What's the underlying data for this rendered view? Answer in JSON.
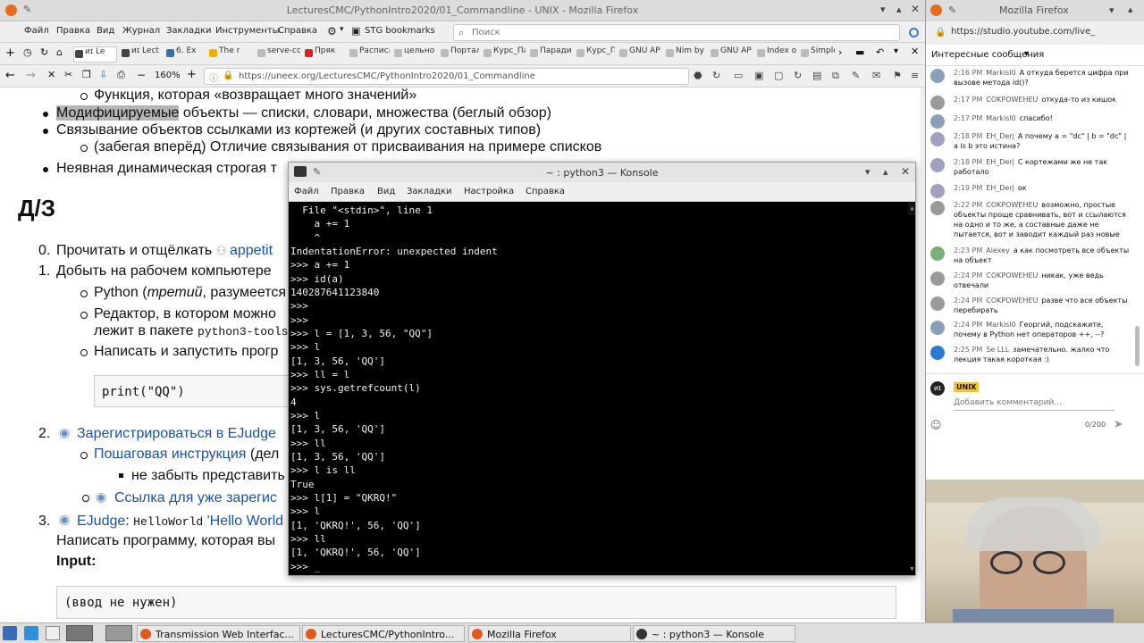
{
  "main_window": {
    "title": "LecturesCMC/PythonIntro2020/01_Commandline - UNIX - Mozilla Firefox",
    "menu": [
      "Файл",
      "Правка",
      "Вид",
      "Журнал",
      "Закладки",
      "Инструменты",
      "Справка"
    ],
    "bookmarks_label": "STG bookmarks",
    "search_placeholder": "Поиск",
    "tabs": [
      {
        "label": "ᴎɪ Le",
        "color": "#444"
      },
      {
        "label": "ᴎɪ Lect",
        "color": "#444"
      },
      {
        "label": "6. Ex",
        "color": "#3a6ea5"
      },
      {
        "label": "The r",
        "color": "#f0b000"
      },
      {
        "label": "serve-co",
        "color": "#bbb"
      },
      {
        "label": "Пряк",
        "color": "#e02020"
      },
      {
        "label": "Расписа",
        "color": "#bbb"
      },
      {
        "label": "цельно",
        "color": "#bbb"
      },
      {
        "label": "Портал",
        "color": "#bbb"
      },
      {
        "label": "Курс_Па",
        "color": "#bbb"
      },
      {
        "label": "Паради",
        "color": "#bbb"
      },
      {
        "label": "Курс_Па",
        "color": "#bbb"
      },
      {
        "label": "GNU AP",
        "color": "#bbb"
      },
      {
        "label": "Nim by",
        "color": "#bbb"
      },
      {
        "label": "GNU AP",
        "color": "#bbb"
      },
      {
        "label": "Index of",
        "color": "#bbb"
      },
      {
        "label": "Simple",
        "color": "#bbb"
      }
    ],
    "zoom": "160%",
    "url": "https://uneex.org/LecturesCMC/PythonIntro2020/01_Commandline"
  },
  "doc": {
    "l1": "Функция, которая «возвращает много значений»",
    "l2a": "Модифицируемые",
    "l2b": " объекты — списки, словари, множества (беглый обзор)",
    "l3": "Связывание объектов ссылками из кортежей (и других составных типов)",
    "l4": "(забегая вперёд) Отличие связывания от присваивания на примере списков",
    "l5": "Неявная динамическая строгая т",
    "h_dz": "Д/З",
    "i0a": "Прочитать и отщёлкать ",
    "i0b": "appetit",
    "i1": "Добыть на рабочем компьютере",
    "i1a_pre": "Python (",
    "i1a_em": "третий",
    "i1a_post": ", разумеется",
    "i1b": "Редактор, в котором можно",
    "i1b2": "лежит в пакете ",
    "i1b2m": "python3-tools",
    "i1c": "Написать и запустить прогр",
    "code1": "print(\"QQ\")",
    "i2": "Зарегистрироваться в EJudge",
    "i2a": "Пошаговая инструкция",
    "i2a_post": " (дел",
    "i2a1": "не забыть представить",
    "i2b": "Ссылка для уже зарегис",
    "i3_link": "EJudge",
    "i3_mid": ": ",
    "i3_mono": "HelloWorld",
    "i3_quote": " 'Hello World",
    "i3b": "Написать программу, которая вы",
    "input_label": "Input:",
    "code2": "(ввод не нужен)",
    "n0": "0.",
    "n1": "1.",
    "n2": "2.",
    "n3": "3."
  },
  "konsole": {
    "title": "~ : python3 — Konsole",
    "menu": [
      "Файл",
      "Правка",
      "Вид",
      "Закладки",
      "Настройка",
      "Справка"
    ],
    "lines": [
      "  File \"<stdin>\", line 1",
      "    a += 1",
      "    ^",
      "IndentationError: unexpected indent",
      ">>> a += 1",
      ">>> id(a)",
      "140287641123840",
      ">>>",
      ">>>",
      ">>> l = [1, 3, 56, \"QQ\"]",
      ">>> l",
      "[1, 3, 56, 'QQ']",
      ">>> ll = l",
      ">>> sys.getrefcount(l)",
      "4",
      ">>> l",
      "[1, 3, 56, 'QQ']",
      ">>> ll",
      "[1, 3, 56, 'QQ']",
      ">>> l is ll",
      "True",
      ">>> l[1] = \"QKRQ!\"",
      ">>> l",
      "[1, 'QKRQ!', 56, 'QQ']",
      ">>> ll",
      "[1, 'QKRQ!', 56, 'QQ']",
      ">>> _"
    ]
  },
  "right_window": {
    "title": "Mozilla Firefox",
    "url": "https://studio.youtube.com/live_",
    "chat_header": "Интересные сообщения",
    "messages": [
      {
        "time": "2:16 PM",
        "author": "Markisl0",
        "text": "А откуда берется цифра при вызове метода id()?"
      },
      {
        "time": "2:17 PM",
        "author": "COKPOWEHEU",
        "text": "откуда-то из кишок"
      },
      {
        "time": "2:17 PM",
        "author": "Markisl0",
        "text": "спасибо!"
      },
      {
        "time": "2:18 PM",
        "author": "EH_Derj",
        "text": "А почему a = \"dc\" | b = \"dc\" | a is b это истина?"
      },
      {
        "time": "2:18 PM",
        "author": "EH_Derj",
        "text": "С кортежами же не так работало"
      },
      {
        "time": "2:19 PM",
        "author": "EH_Derj",
        "text": "ок"
      },
      {
        "time": "2:22 PM",
        "author": "COKPOWEHEU",
        "text": "возможно, простые объекты проще сравнивать, вот и ссылаются на одно и то же, а составные даже не пытается, вот и заводит каждый раз новые"
      },
      {
        "time": "2:23 PM",
        "author": "Alexey",
        "text": "а как посмотреть все объекты на объект"
      },
      {
        "time": "2:24 PM",
        "author": "COKPOWEHEU",
        "text": "никак, уже ведь отвечали"
      },
      {
        "time": "2:24 PM",
        "author": "COKPOWEHEU",
        "text": "разве что все объекты перебирать"
      },
      {
        "time": "2:24 PM",
        "author": "Markisl0",
        "text": "Георгий, подскажите, почему в Python нет операторов ++, --?"
      },
      {
        "time": "2:25 PM",
        "author": "Se LLL",
        "text": "замечательно. жалко что лекция такая короткая :)"
      }
    ],
    "channel_badge": "UNIX",
    "comment_placeholder": "Добавить комментарий...",
    "char_count": "0/200",
    "avatar_text": "ᴎɪ"
  },
  "taskbar": {
    "tasks": [
      {
        "label": "Transmission Web Interfac...",
        "color": "#e05a1e"
      },
      {
        "label": "LecturesCMC/PythonIntro...",
        "color": "#e05a1e"
      },
      {
        "label": "Mozilla Firefox",
        "color": "#e05a1e"
      },
      {
        "label": "~ : python3 — Konsole",
        "color": "#333"
      }
    ]
  }
}
